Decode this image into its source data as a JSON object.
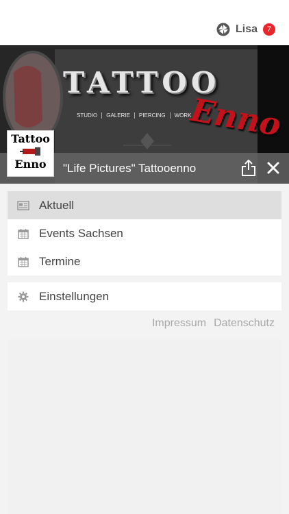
{
  "header": {
    "user_name": "Lisa",
    "notification_count": "7",
    "user_logo_icon": "swirl-logo-icon"
  },
  "banner": {
    "word_tattoo": "TATTOO",
    "word_enno": "Enno",
    "nav": [
      "STUDIO",
      "GALERIE",
      "PIERCING",
      "WORK"
    ]
  },
  "profile": {
    "thumb_line1": "Tattoo",
    "thumb_line2": "Enno",
    "title": "\"Life Pictures\" Tattooenno",
    "share_icon": "share-icon",
    "close_icon": "close-icon"
  },
  "menu": {
    "items": [
      {
        "label": "Aktuell",
        "icon": "newspaper-icon",
        "active": true
      },
      {
        "label": "Events Sachsen",
        "icon": "calendar-icon",
        "active": false
      },
      {
        "label": "Termine",
        "icon": "calendar-icon",
        "active": false
      }
    ],
    "settings": {
      "label": "Einstellungen",
      "icon": "gear-icon"
    }
  },
  "footer_links": {
    "impressum": "Impressum",
    "datenschutz": "Datenschutz"
  },
  "colors": {
    "badge": "#e8262b",
    "enno_red": "#c3121b",
    "active_item": "#dedede"
  }
}
